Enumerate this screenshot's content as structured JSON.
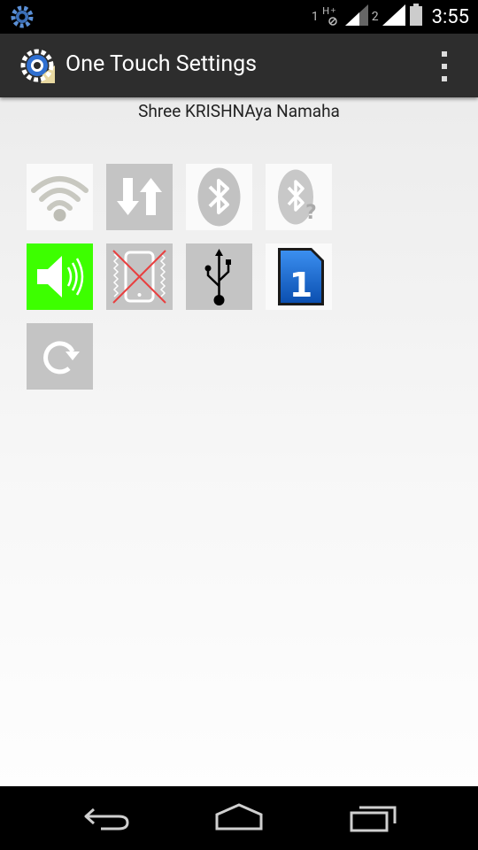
{
  "status_bar": {
    "app_icon": "settings-gear-icon",
    "sim1_label": "1",
    "sim2_label": "2",
    "time": "3:55"
  },
  "action_bar": {
    "title": "One Touch Settings",
    "app_icon": "one-touch-settings-icon",
    "overflow_icon": "overflow-menu-icon"
  },
  "subtitle": "Shree KRISHNAya Namaha",
  "toggles": [
    {
      "icon": "wifi-icon",
      "state": "off"
    },
    {
      "icon": "mobile-data-icon",
      "state": "off"
    },
    {
      "icon": "bluetooth-icon",
      "state": "off"
    },
    {
      "icon": "bluetooth-visibility-icon",
      "state": "off"
    },
    {
      "icon": "sound-icon",
      "state": "on",
      "active_color": "#3dff00"
    },
    {
      "icon": "vibrate-icon",
      "state": "off"
    },
    {
      "icon": "usb-icon",
      "state": "off"
    },
    {
      "icon": "sim-card-icon",
      "state": "sim 1",
      "label": "1"
    },
    {
      "icon": "auto-rotate-icon",
      "state": "off"
    }
  ],
  "nav_bar": {
    "back": "back-icon",
    "home": "home-icon",
    "recents": "recents-icon"
  }
}
